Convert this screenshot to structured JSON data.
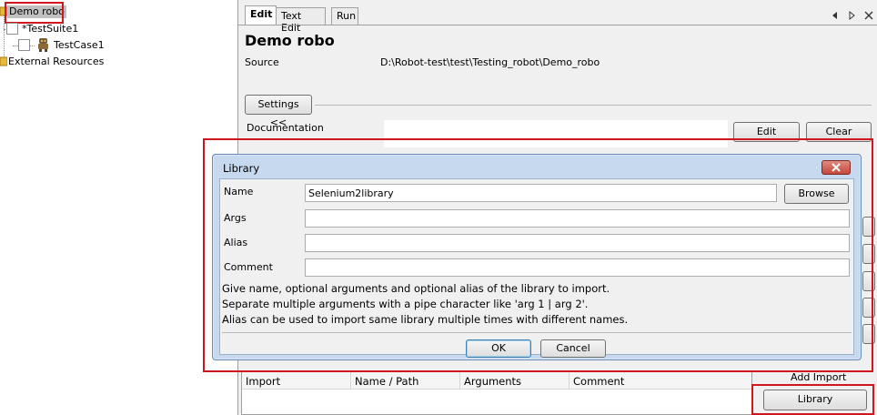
{
  "tree": {
    "root_label": "Demo robo",
    "suite_label": "*TestSuite1",
    "case_label": "TestCase1",
    "resources_label": "External Resources"
  },
  "tabs": {
    "edit": "Edit",
    "text_edit": "Text Edit",
    "run": "Run"
  },
  "editor": {
    "title": "Demo robo",
    "source_label": "Source",
    "source_value": "D:\\Robot-test\\test\\Testing_robot\\Demo_robo",
    "settings_button": "Settings <<",
    "documentation_label": "Documentation",
    "edit_button": "Edit",
    "clear_button": "Clear"
  },
  "dialog": {
    "title": "Library",
    "name_label": "Name",
    "name_value": "Selenium2library",
    "browse_button": "Browse",
    "args_label": "Args",
    "args_value": "",
    "alias_label": "Alias",
    "alias_value": "",
    "comment_label": "Comment",
    "comment_value": "",
    "help_line1": "Give name, optional arguments and optional alias of the library to import.",
    "help_line2": "Separate multiple arguments with a pipe character like 'arg 1 | arg 2'.",
    "help_line3": "Alias can be used to import same library multiple times with different names.",
    "ok_button": "OK",
    "cancel_button": "Cancel"
  },
  "imports_table": {
    "columns": [
      "Import",
      "Name / Path",
      "Arguments",
      "Comment"
    ],
    "add_import_label": "Add Import",
    "library_button": "Library"
  },
  "colors": {
    "highlight_red": "#d2161f",
    "dialog_frame": "#c6d9ee",
    "close_button": "#c7473b"
  }
}
